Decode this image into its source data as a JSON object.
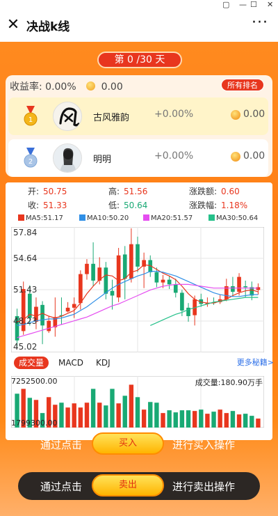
{
  "window": {
    "controls": [
      "▢",
      "—",
      "☐",
      "✕"
    ]
  },
  "header": {
    "title": "决战k线",
    "close_glyph": "✕",
    "more_glyph": "···"
  },
  "game": {
    "round": "第 0 /30 天"
  },
  "summary": {
    "profit_label": "收益率:",
    "profit_value": "0.00%",
    "coin_value": "0.00",
    "rank_button": "所有排名"
  },
  "players": [
    {
      "name": "古风雅韵",
      "rate": "+0.00%",
      "coins": "0.00",
      "medal_color": "#f4b61a",
      "medal_number": "1"
    },
    {
      "name": "明明",
      "rate": "+0.00%",
      "coins": "0.00",
      "medal_color": "#7fa7d8",
      "medal_number": "2"
    }
  ],
  "quote": {
    "open_label": "开:",
    "open": "50.75",
    "high_label": "高:",
    "high": "51.56",
    "change_label": "涨跌额:",
    "change": "0.60",
    "close_label": "收:",
    "close": "51.33",
    "low_label": "低:",
    "low": "50.64",
    "pct_label": "涨跌幅:",
    "pct": "1.18%"
  },
  "ma_legend": [
    {
      "label": "MA5:51.17",
      "color": "#e8361e"
    },
    {
      "label": "MA10:50.20",
      "color": "#2f8fe6"
    },
    {
      "label": "MA20:51.57",
      "color": "#e54df0"
    },
    {
      "label": "MA30:50.64",
      "color": "#25c08a"
    }
  ],
  "indicators": {
    "tabs": [
      "成交量",
      "MACD",
      "KDJ"
    ],
    "more": "更多秘籍>"
  },
  "volume": {
    "max_label": "7252500.00",
    "min_label": "1799300.00",
    "current_label": "成交量:180.90万手"
  },
  "actions": {
    "buy_prefix": "通过点击",
    "buy_button": "买入",
    "buy_suffix": "进行买入操作",
    "sell_prefix": "通过点击",
    "sell_button": "卖出",
    "sell_suffix": "进行卖出操作"
  },
  "colors": {
    "up": "#e8361e",
    "down": "#19a974",
    "accent": "#ff7a12"
  },
  "chart_data": {
    "type": "candlestick",
    "price_axis": [
      "57.84",
      "54.64",
      "51.43",
      "48.23",
      "45.02"
    ],
    "ylim": [
      45.02,
      57.84
    ],
    "candles": [
      {
        "o": 48.6,
        "c": 46.0,
        "h": 49.4,
        "l": 45.3
      },
      {
        "o": 47.0,
        "c": 51.5,
        "h": 52.3,
        "l": 46.6
      },
      {
        "o": 51.0,
        "c": 48.4,
        "h": 51.9,
        "l": 47.6
      },
      {
        "o": 48.0,
        "c": 49.6,
        "h": 50.6,
        "l": 47.2
      },
      {
        "o": 49.8,
        "c": 47.6,
        "h": 50.2,
        "l": 45.6
      },
      {
        "o": 47.0,
        "c": 48.1,
        "h": 48.6,
        "l": 46.8
      },
      {
        "o": 47.4,
        "c": 48.5,
        "h": 50.6,
        "l": 46.4
      },
      {
        "o": 48.7,
        "c": 48.6,
        "h": 50.6,
        "l": 47.7
      },
      {
        "o": 49.1,
        "c": 49.5,
        "h": 50.1,
        "l": 49.0
      },
      {
        "o": 49.5,
        "c": 49.9,
        "h": 50.6,
        "l": 48.4
      },
      {
        "o": 50.0,
        "c": 53.1,
        "h": 53.5,
        "l": 49.3
      },
      {
        "o": 53.1,
        "c": 54.2,
        "h": 54.7,
        "l": 52.5
      },
      {
        "o": 54.2,
        "c": 52.4,
        "h": 56.5,
        "l": 51.8
      },
      {
        "o": 52.4,
        "c": 53.8,
        "h": 54.9,
        "l": 52.0
      },
      {
        "o": 53.8,
        "c": 51.0,
        "h": 54.4,
        "l": 50.4
      },
      {
        "o": 51.3,
        "c": 50.8,
        "h": 52.5,
        "l": 49.3
      },
      {
        "o": 50.6,
        "c": 55.1,
        "h": 55.9,
        "l": 50.1
      },
      {
        "o": 55.2,
        "c": 52.6,
        "h": 56.1,
        "l": 50.4
      },
      {
        "o": 52.6,
        "c": 56.3,
        "h": 58.0,
        "l": 52.2
      },
      {
        "o": 56.3,
        "c": 53.9,
        "h": 57.1,
        "l": 53.3
      },
      {
        "o": 53.9,
        "c": 54.6,
        "h": 55.4,
        "l": 51.6
      },
      {
        "o": 54.6,
        "c": 53.3,
        "h": 55.1,
        "l": 52.8
      },
      {
        "o": 53.3,
        "c": 52.2,
        "h": 53.8,
        "l": 51.7
      },
      {
        "o": 52.2,
        "c": 52.5,
        "h": 53.0,
        "l": 51.6
      },
      {
        "o": 52.5,
        "c": 52.0,
        "h": 52.9,
        "l": 51.5
      },
      {
        "o": 52.0,
        "c": 51.1,
        "h": 52.6,
        "l": 50.6
      },
      {
        "o": 51.1,
        "c": 49.2,
        "h": 51.4,
        "l": 48.6
      },
      {
        "o": 49.5,
        "c": 48.6,
        "h": 50.0,
        "l": 48.0
      },
      {
        "o": 48.7,
        "c": 50.4,
        "h": 50.8,
        "l": 47.6
      },
      {
        "o": 50.4,
        "c": 49.9,
        "h": 51.0,
        "l": 49.6
      },
      {
        "o": 50.0,
        "c": 50.0,
        "h": 50.6,
        "l": 49.6
      },
      {
        "o": 50.1,
        "c": 50.0,
        "h": 50.6,
        "l": 49.8
      },
      {
        "o": 50.1,
        "c": 50.4,
        "h": 50.9,
        "l": 49.9
      },
      {
        "o": 50.4,
        "c": 51.8,
        "h": 52.6,
        "l": 50.2
      },
      {
        "o": 51.8,
        "c": 51.2,
        "h": 52.8,
        "l": 50.7
      },
      {
        "o": 51.2,
        "c": 52.8,
        "h": 53.2,
        "l": 50.8
      },
      {
        "o": 51.8,
        "c": 51.7,
        "h": 52.4,
        "l": 50.6
      },
      {
        "o": 51.7,
        "c": 50.8,
        "h": 52.3,
        "l": 50.3
      },
      {
        "o": 51.4,
        "c": 51.7,
        "h": 52.1,
        "l": 50.9
      }
    ],
    "ma_lines": [
      {
        "name": "MA5",
        "color": "#e8361e",
        "values": [
          48.0,
          48.2,
          48.8,
          48.6,
          48.9,
          48.6,
          48.4,
          48.6,
          48.9,
          49.2,
          50.0,
          51.0,
          51.8,
          52.5,
          53.0,
          52.9,
          52.4,
          52.6,
          53.3,
          53.5,
          54.1,
          54.0,
          53.6,
          53.2,
          52.9,
          52.5,
          51.8,
          51.0,
          50.4,
          50.1,
          50.0,
          50.0,
          50.2,
          50.4,
          50.8,
          51.1,
          51.3,
          51.4,
          51.2
        ]
      },
      {
        "name": "MA10",
        "color": "#2f8fe6",
        "values": [
          47.6,
          47.7,
          47.9,
          48.1,
          48.2,
          48.3,
          48.3,
          48.4,
          48.6,
          48.8,
          49.2,
          49.6,
          50.1,
          50.6,
          51.1,
          51.6,
          52.0,
          52.3,
          52.6,
          52.9,
          53.1,
          53.4,
          53.4,
          53.3,
          53.1,
          52.9,
          52.6,
          52.3,
          52.0,
          51.7,
          51.4,
          51.1,
          50.9,
          50.8,
          50.7,
          50.7,
          50.8,
          50.9,
          50.9
        ]
      },
      {
        "name": "MA20",
        "color": "#e54df0",
        "values": [
          46.3,
          46.5,
          46.7,
          46.9,
          47.1,
          47.3,
          47.5,
          47.7,
          47.9,
          48.1,
          48.3,
          48.5,
          48.8,
          49.1,
          49.4,
          49.7,
          49.9,
          50.2,
          50.5,
          50.8,
          51.1,
          51.4,
          51.6,
          51.8,
          51.9,
          52.0,
          52.0,
          52.0,
          51.9,
          51.8,
          51.7,
          51.6,
          51.6,
          51.6,
          51.6,
          51.6,
          51.6,
          51.6,
          51.6
        ]
      },
      {
        "name": "MA30",
        "color": "#25c08a",
        "values": [
          null,
          null,
          null,
          null,
          null,
          null,
          null,
          null,
          null,
          null,
          null,
          null,
          null,
          null,
          null,
          null,
          null,
          null,
          null,
          null,
          null,
          47.6,
          47.9,
          48.2,
          48.5,
          48.8,
          49.0,
          49.3,
          49.5,
          49.7,
          49.9,
          50.1,
          50.2,
          50.3,
          50.4,
          50.5,
          50.6,
          50.6,
          50.6
        ]
      }
    ],
    "volume": [
      4.9,
      5.6,
      4.3,
      4.0,
      2.1,
      4.4,
      3.3,
      3.6,
      2.9,
      3.5,
      2.9,
      3.6,
      5.6,
      3.6,
      3.2,
      5.6,
      3.5,
      4.6,
      6.2,
      4.4,
      2.6,
      3.7,
      3.6,
      2.1,
      2.5,
      2.2,
      2.5,
      2.5,
      2.4,
      2.6,
      2.0,
      2.3,
      2.6,
      2.1,
      2.4,
      1.9,
      2.0,
      1.7,
      1.3
    ],
    "volume_ylim": [
      0,
      7.2525
    ]
  }
}
